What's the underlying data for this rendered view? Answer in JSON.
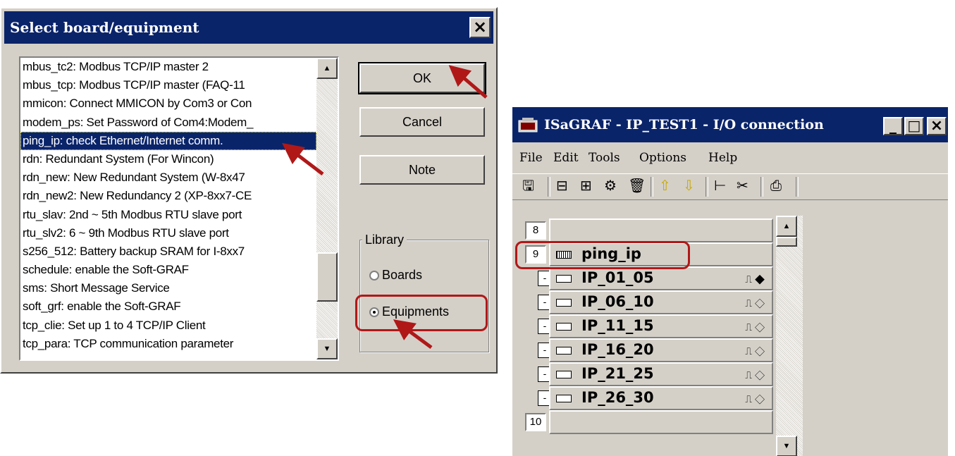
{
  "dialog": {
    "title": "Select board/equipment",
    "close_label": "×",
    "items": [
      "mbus_tc2: Modbus TCP/IP master 2",
      "mbus_tcp: Modbus TCP/IP master (FAQ-11",
      "mmicon: Connect MMICON by Com3 or Con",
      "modem_ps: Set Password of Com4:Modem_",
      "ping_ip: check Ethernet/Internet comm.",
      "rdn: Redundant System (For Wincon)",
      "rdn_new: New Redundant System (W-8x47",
      "rdn_new2: New Redundancy 2 (XP-8xx7-CE",
      "rtu_slav: 2nd ~ 5th Modbus RTU slave port",
      "rtu_slv2: 6 ~ 9th Modbus RTU slave port",
      "s256_512: Battery backup SRAM for I-8xx7",
      "schedule: enable the Soft-GRAF",
      "sms: Short Message Service",
      "soft_grf: enable the Soft-GRAF",
      "tcp_clie: Set up 1 to 4 TCP/IP Client",
      "tcp_para: TCP communication parameter"
    ],
    "selected_item": "ping_ip: check Ethernet/Internet comm.",
    "buttons": {
      "ok": "OK",
      "cancel": "Cancel",
      "note": "Note"
    },
    "library": {
      "label": "Library",
      "options": [
        "Boards",
        "Equipments"
      ],
      "selected": "Equipments"
    }
  },
  "io_window": {
    "title": "ISaGRAF - IP_TEST1 - I/O connection",
    "window_buttons": {
      "minimize": "_",
      "maximize": "□",
      "close": "×"
    },
    "menu": [
      "File",
      "Edit",
      "Tools",
      "Options",
      "Help"
    ],
    "rows": [
      {
        "slot": "8",
        "label": ""
      },
      {
        "slot": "9",
        "label": "ping_ip"
      },
      {
        "slot": "-",
        "label": "IP_01_05",
        "mark": "⎍ ◆"
      },
      {
        "slot": "-",
        "label": "IP_06_10",
        "mark": "⎍ ◇"
      },
      {
        "slot": "-",
        "label": "IP_11_15",
        "mark": "⎍ ◇"
      },
      {
        "slot": "-",
        "label": "IP_16_20",
        "mark": "⎍ ◇"
      },
      {
        "slot": "-",
        "label": "IP_21_25",
        "mark": "⎍ ◇"
      },
      {
        "slot": "-",
        "label": "IP_26_30",
        "mark": "⎍ ◇"
      },
      {
        "slot": "10",
        "label": ""
      }
    ]
  },
  "colors": {
    "titlebar": "#0a246a",
    "face": "#d4d0c8",
    "highlight": "#b01818"
  }
}
